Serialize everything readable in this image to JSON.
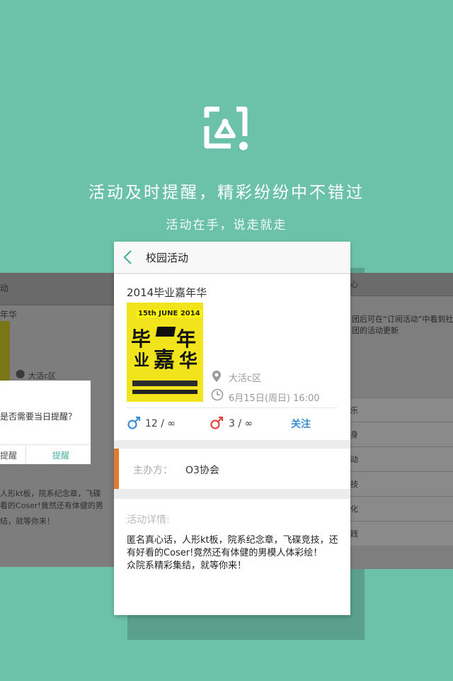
{
  "promo": {
    "tagline": "活动及时提醒，精彩纷纷中不错过",
    "subtagline": "活动在手，说走就走",
    "icon": "activity-app-logo-icon"
  },
  "left_screen": {
    "title_fragment": "动",
    "item_title_fragment": "年华",
    "location_fragment": "大活c区",
    "dialog_question": "是否需要当日提醒？",
    "dialog_cancel": "提醒",
    "dialog_confirm": "提醒",
    "detail_line1": "人形kt板，院系纪念章，飞碟",
    "detail_line2": "看的Coser!竟然还有体健的男",
    "detail_line3": "结，就等你来！"
  },
  "right_screen": {
    "title_fragment": "心",
    "info_line1": "团后可在“订阅活动”中看到社",
    "info_line2": "团的活动更新",
    "rows": [
      "乐",
      "身",
      "动",
      "技",
      "化",
      "践"
    ]
  },
  "card": {
    "header_title": "校园活动",
    "event_title": "2014毕业嘉年华",
    "poster": {
      "date_text": "15th JUNE 2014",
      "big_chars": [
        "毕",
        "年",
        "业",
        "嘉",
        "华"
      ]
    },
    "location": "大活c区",
    "time": "6月15日(周日) 16:00",
    "male_count": "12 / ∞",
    "female_count": "3 / ∞",
    "follow_label": "关注",
    "organizer_label": "主办方：",
    "organizer_value": "O3协会",
    "detail_label": "活动详情:",
    "detail_text": "匿名真心话，人形kt板，院系纪念章，飞碟竞技，还有好看的Coser!竟然还有体健的男模人体彩绘！\n众院系精彩集结，就等你来！",
    "accent_color": "#e07b2e",
    "follow_color": "#3a8fd6"
  },
  "background_color": "#6cc2a8"
}
